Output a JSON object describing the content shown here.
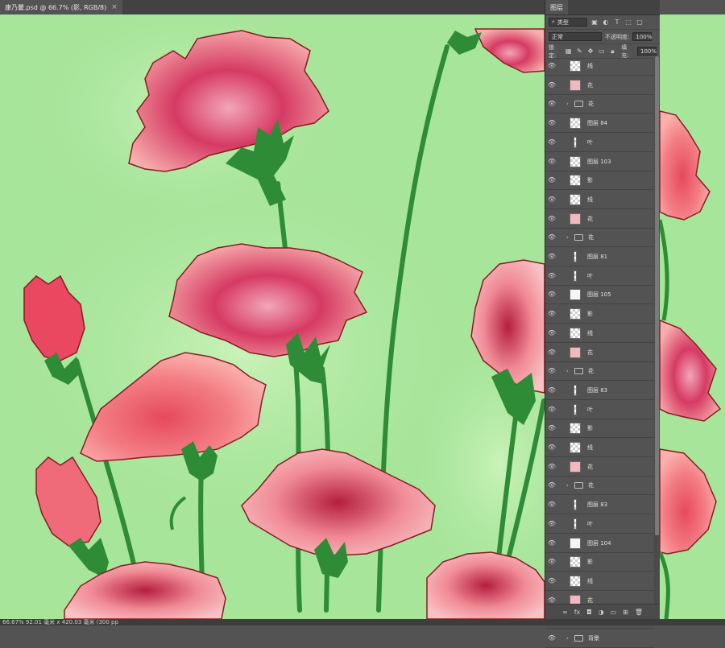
{
  "document": {
    "tab_title": "康乃馨.psd @ 66.7% (影, RGB/8)",
    "close_glyph": "×"
  },
  "status_bar": {
    "text": "66.67%   92.01 毫米 x 420.03 毫米 (300 pp"
  },
  "layers_panel": {
    "title": "图层",
    "filter_label": "类型",
    "blend_mode": "正常",
    "opacity_label": "不透明度:",
    "opacity_value": "100%",
    "lock_label": "锁定:",
    "fill_label": "填充:",
    "fill_value": "100%",
    "layers": [
      {
        "name": "线",
        "type": "layer",
        "thumb": "checker"
      },
      {
        "name": "花",
        "type": "layer",
        "thumb": "pink"
      },
      {
        "name": "花",
        "type": "group"
      },
      {
        "name": "图层 84",
        "type": "layer",
        "thumb": "checker"
      },
      {
        "name": "叶",
        "type": "layer",
        "thumb": "narrow"
      },
      {
        "name": "图层 103",
        "type": "layer",
        "thumb": "checker"
      },
      {
        "name": "影",
        "type": "layer",
        "thumb": "checker"
      },
      {
        "name": "线",
        "type": "layer",
        "thumb": "checker"
      },
      {
        "name": "花",
        "type": "layer",
        "thumb": "pink"
      },
      {
        "name": "花",
        "type": "group"
      },
      {
        "name": "图层 81",
        "type": "layer",
        "thumb": "narrow"
      },
      {
        "name": "叶",
        "type": "layer",
        "thumb": "narrow"
      },
      {
        "name": "图层 105",
        "type": "layer",
        "thumb": "white"
      },
      {
        "name": "影",
        "type": "layer",
        "thumb": "checker"
      },
      {
        "name": "线",
        "type": "layer",
        "thumb": "checker"
      },
      {
        "name": "花",
        "type": "layer",
        "thumb": "pink"
      },
      {
        "name": "花",
        "type": "group"
      },
      {
        "name": "图层 83",
        "type": "layer",
        "thumb": "narrow"
      },
      {
        "name": "叶",
        "type": "layer",
        "thumb": "narrow"
      },
      {
        "name": "影",
        "type": "layer",
        "thumb": "checker"
      },
      {
        "name": "线",
        "type": "layer",
        "thumb": "checker"
      },
      {
        "name": "花",
        "type": "layer",
        "thumb": "pink"
      },
      {
        "name": "花",
        "type": "group"
      },
      {
        "name": "图层 83",
        "type": "layer",
        "thumb": "narrow"
      },
      {
        "name": "叶",
        "type": "layer",
        "thumb": "narrow"
      },
      {
        "name": "图层 104",
        "type": "layer",
        "thumb": "white"
      },
      {
        "name": "影",
        "type": "layer",
        "thumb": "checker"
      },
      {
        "name": "线",
        "type": "layer",
        "thumb": "checker"
      },
      {
        "name": "花",
        "type": "layer",
        "thumb": "pink"
      },
      {
        "name": "花",
        "type": "group"
      },
      {
        "name": "背景",
        "type": "group"
      }
    ]
  },
  "colors": {
    "canvas_bg": "#a7e59a",
    "petal_light": "#f6a3a8",
    "petal_dark": "#c3264a",
    "stem": "#2e8b36",
    "outline": "#8a1a22"
  }
}
